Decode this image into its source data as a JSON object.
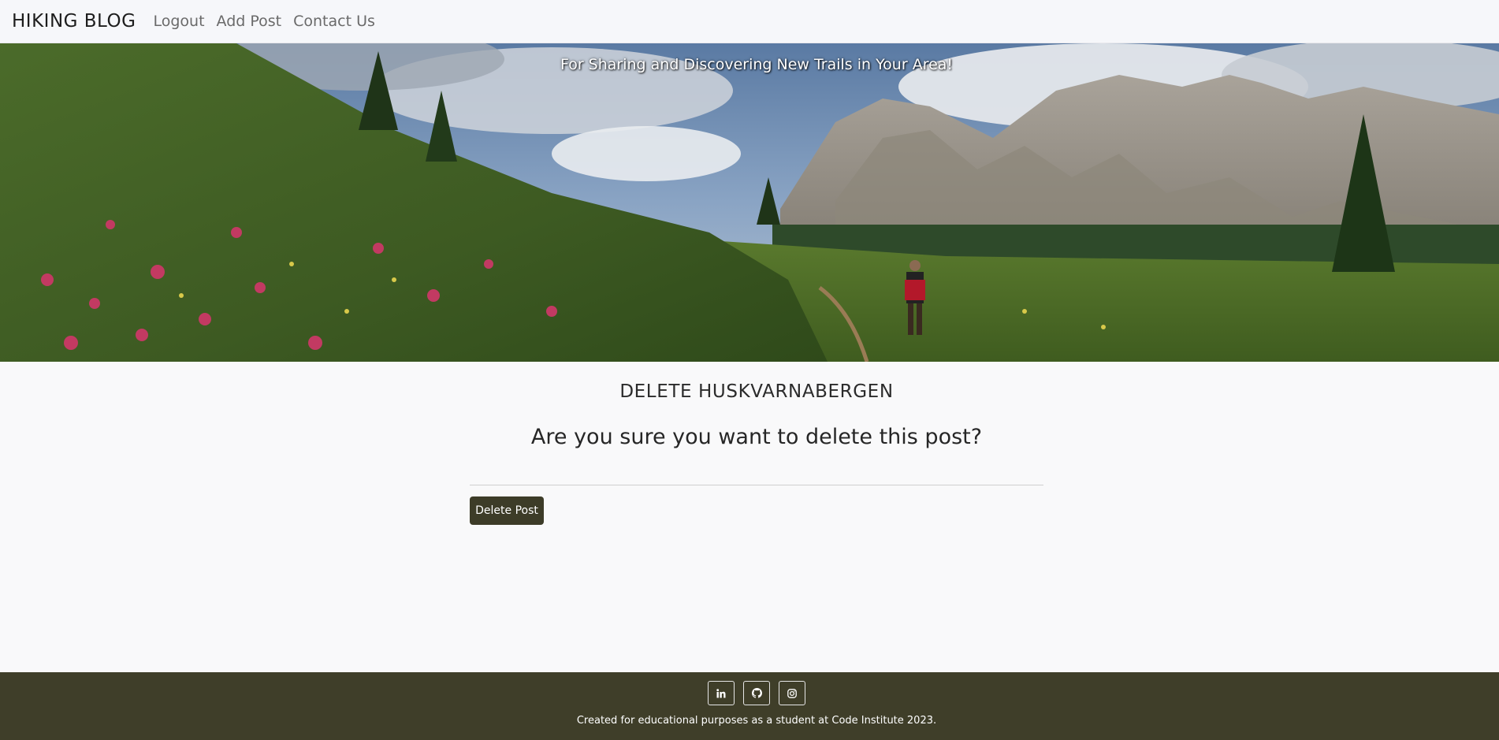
{
  "navbar": {
    "brand": "HIKING BLOG",
    "links": [
      {
        "label": "Logout"
      },
      {
        "label": "Add Post"
      },
      {
        "label": "Contact Us"
      }
    ]
  },
  "hero": {
    "tagline": "For Sharing and Discovering New Trails in Your Area!"
  },
  "main": {
    "title": "DELETE HUSKVARNABERGEN",
    "question": "Are you sure you want to delete this post?",
    "delete_button_label": "Delete Post",
    "button_color": "#3d3c28"
  },
  "footer": {
    "social": [
      {
        "icon": "linkedin-icon"
      },
      {
        "icon": "github-icon"
      },
      {
        "icon": "instagram-icon"
      }
    ],
    "text": "Created for educational purposes as a student at Code Institute 2023.",
    "background": "#3f3e29"
  }
}
